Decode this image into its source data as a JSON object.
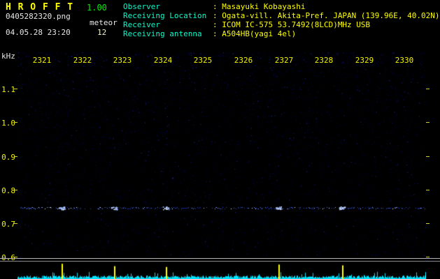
{
  "header": {
    "title": "H R O F F T",
    "version": "1.00",
    "filename": "0405282320.png",
    "mode": "meteor",
    "datetime": "04.05.28 23:20",
    "echo_count": "12",
    "separator": ": ",
    "info": [
      {
        "label": "Observer",
        "value": "Masayuki Kobayashi"
      },
      {
        "label": "Receiving Location",
        "value": "Ogata-vill. Akita-Pref. JAPAN (139.96E, 40.02N)"
      },
      {
        "label": "Receiver",
        "value": "ICOM IC-575 53.7492(8LCD)MHz USB"
      },
      {
        "label": "Receiving antenna",
        "value": "A504HB(yagi 4el)"
      }
    ]
  },
  "chart_data": {
    "type": "heatmap",
    "title": "HROFFT 10-minute radio meteor spectrogram",
    "ylabel": "kHz",
    "xlabel": "",
    "x_tick_labels": [
      "2321",
      "2322",
      "2323",
      "2324",
      "2325",
      "2326",
      "2327",
      "2328",
      "2329",
      "2330"
    ],
    "y_tick_labels": [
      "1.1",
      "1.0",
      "0.9",
      "0.8",
      "0.7",
      "0.6"
    ],
    "x_range_time": [
      "23:20",
      "23:30"
    ],
    "y_range_khz": [
      0.6,
      1.21
    ],
    "carrier_band_khz": 0.745,
    "echo_time_fractions": [
      0.108,
      0.236,
      0.363,
      0.639,
      0.794
    ],
    "grid": false,
    "legend": false,
    "colors": {
      "background": "#000000",
      "noise_blue": "#000066",
      "carrier_blue": "#2b46d8",
      "carrier_bright": "#99bbff",
      "carrier_peak": "#ffffff",
      "tick_label": "#f2f200",
      "axis_unit": "#e8e8e8"
    },
    "amplitude_strip": {
      "baseline_color": "#00e5ff",
      "event_color": "#ffff00",
      "events": [
        {
          "x": 0.108,
          "h": 0.95
        },
        {
          "x": 0.236,
          "h": 0.8
        },
        {
          "x": 0.363,
          "h": 0.75
        },
        {
          "x": 0.639,
          "h": 0.9
        },
        {
          "x": 0.794,
          "h": 0.85
        }
      ]
    }
  }
}
